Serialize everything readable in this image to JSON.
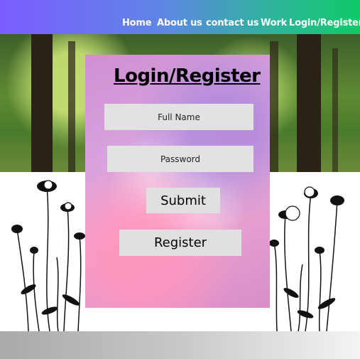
{
  "nav": {
    "home": "Home",
    "about": "About  us",
    "contact": "contact us",
    "work": "Work",
    "login": "Login/Register"
  },
  "form": {
    "title": "Login/Register",
    "name_placeholder": "Full Name",
    "password_placeholder": "Password",
    "submit_label": "Submit",
    "register_label": "Register"
  },
  "colors": {
    "header_start": "#7b5cff",
    "header_end": "#0fca67",
    "card": "#d7a3df"
  }
}
